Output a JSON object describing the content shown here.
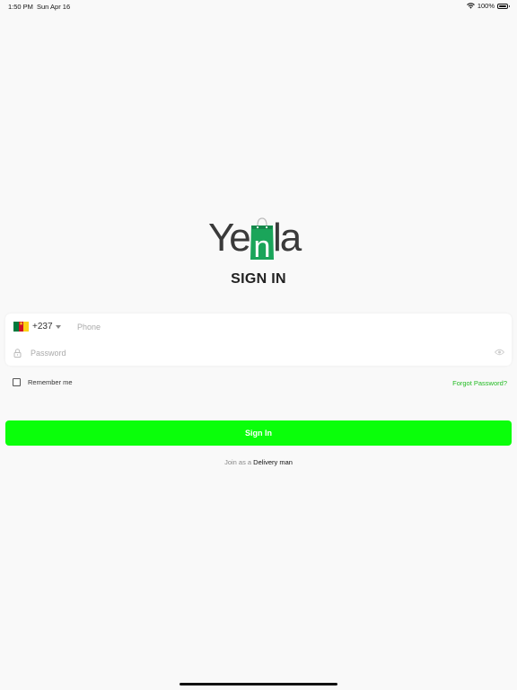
{
  "status_bar": {
    "time": "1:50 PM",
    "date": "Sun Apr 16",
    "battery": "100%",
    "icons": [
      "wifi-icon",
      "battery-icon"
    ]
  },
  "logo": {
    "part_left": "Ye",
    "part_bag": "n",
    "part_right": "la",
    "bag_color": "#1aa55a"
  },
  "page": {
    "title": "SIGN IN"
  },
  "form": {
    "country_flag": "flag-cameroon-icon",
    "country_code": "+237",
    "phone_placeholder": "Phone",
    "phone_value": "",
    "password_placeholder": "Password",
    "password_value": "",
    "lock_icon": "lock-icon",
    "eye_icon": "eye-icon"
  },
  "options": {
    "remember_label": "Remember me",
    "remember_checked": false,
    "forgot_label": "Forgot Password?"
  },
  "actions": {
    "signin_label": "Sign In",
    "join_prefix": "Join as a",
    "join_link": "Delivery man"
  },
  "colors": {
    "accent": "#0aff0a",
    "link_green": "#22bb22",
    "background": "#f9f9f9"
  }
}
